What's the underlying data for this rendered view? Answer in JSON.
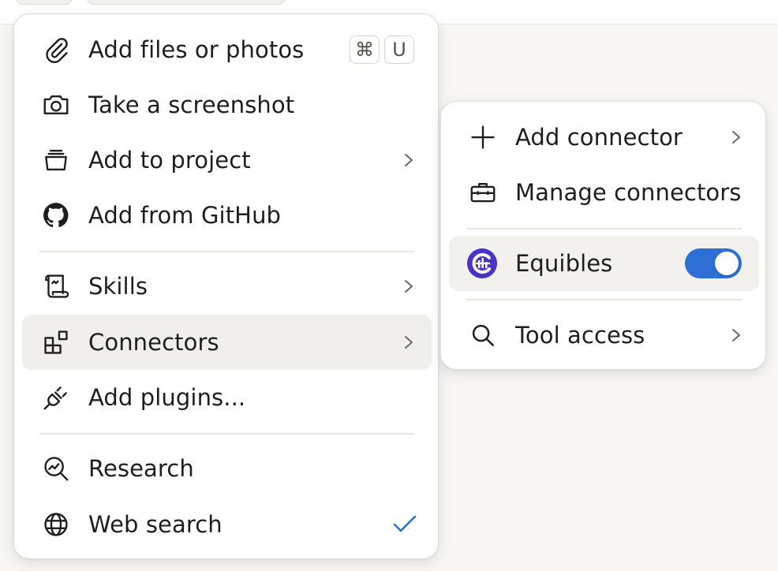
{
  "main_menu": {
    "items": [
      {
        "label": "Add files or photos",
        "icon": "paperclip-icon",
        "shortcut": [
          "⌘",
          "U"
        ]
      },
      {
        "label": "Take a screenshot",
        "icon": "camera-icon"
      },
      {
        "label": "Add to project",
        "icon": "project-icon",
        "has_submenu": true
      },
      {
        "label": "Add from GitHub",
        "icon": "github-icon"
      },
      {
        "label": "Skills",
        "icon": "scroll-icon",
        "has_submenu": true
      },
      {
        "label": "Connectors",
        "icon": "connectors-icon",
        "has_submenu": true,
        "active": true
      },
      {
        "label": "Add plugins...",
        "icon": "plug-icon"
      },
      {
        "label": "Research",
        "icon": "research-icon"
      },
      {
        "label": "Web search",
        "icon": "globe-icon",
        "checked": true
      }
    ]
  },
  "submenu": {
    "items": [
      {
        "label": "Add connector",
        "icon": "plus-icon",
        "has_submenu": true
      },
      {
        "label": "Manage connectors",
        "icon": "toolbox-icon"
      },
      {
        "label": "Equibles",
        "icon": "equibles-logo-icon",
        "toggle_on": true
      },
      {
        "label": "Tool access",
        "icon": "search-icon",
        "has_submenu": true
      }
    ]
  },
  "colors": {
    "accent": "#2d6fd4",
    "text": "#1f1e1d",
    "active_bg": "#f0efec"
  }
}
